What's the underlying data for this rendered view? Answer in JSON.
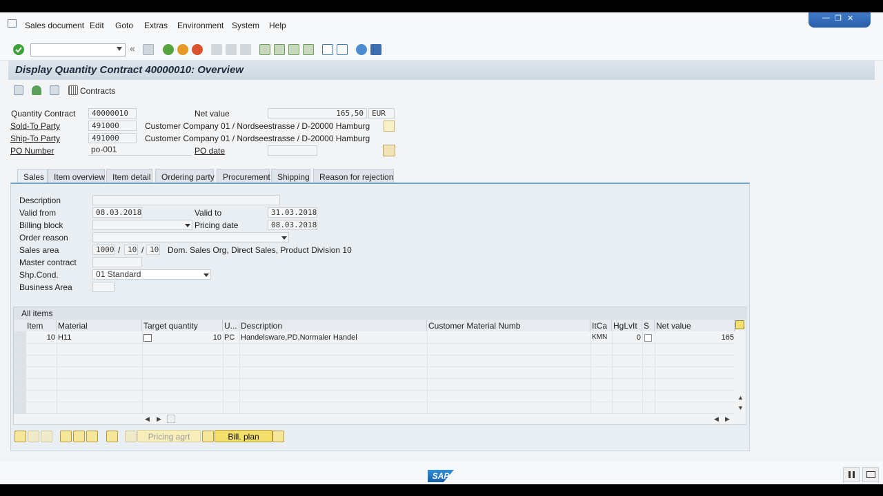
{
  "menu": {
    "items": [
      "Sales document",
      "Edit",
      "Goto",
      "Extras",
      "Environment",
      "System",
      "Help"
    ]
  },
  "window_controls": {
    "minimize": "—",
    "restore": "❐",
    "close": "✕"
  },
  "title": "Display Quantity Contract 40000010: Overview",
  "app_toolbar": {
    "contracts_label": "Contracts"
  },
  "header": {
    "quantity_contract_label": "Quantity Contract",
    "quantity_contract_value": "40000010",
    "net_value_label": "Net value",
    "net_value": "165,50",
    "currency": "EUR",
    "sold_to_label": "Sold-To Party",
    "sold_to_value": "491000",
    "sold_to_desc": "Customer Company 01 / Nordseestrasse / D-20000 Hamburg",
    "ship_to_label": "Ship-To Party",
    "ship_to_value": "491000",
    "ship_to_desc": "Customer Company 01 / Nordseestrasse / D-20000 Hamburg",
    "po_number_label": "PO Number",
    "po_number_value": "po-001",
    "po_date_label": "PO date",
    "po_date_value": ""
  },
  "tabs": [
    "Sales",
    "Item overview",
    "Item detail",
    "Ordering party",
    "Procurement",
    "Shipping",
    "Reason for rejection"
  ],
  "sales_tab": {
    "description_label": "Description",
    "description_value": "",
    "valid_from_label": "Valid from",
    "valid_from_value": "08.03.2018",
    "valid_to_label": "Valid to",
    "valid_to_value": "31.03.2018",
    "billing_block_label": "Billing block",
    "billing_block_value": "",
    "pricing_date_label": "Pricing date",
    "pricing_date_value": "08.03.2018",
    "order_reason_label": "Order reason",
    "order_reason_value": "",
    "sales_area_label": "Sales area",
    "sales_org": "1000",
    "dist_channel": "10",
    "division": "10",
    "sep1": "/",
    "sep2": "/",
    "sales_area_desc": "Dom. Sales Org, Direct Sales, Product Division 10",
    "master_contract_label": "Master contract",
    "master_contract_value": "",
    "shp_cond_label": "Shp.Cond.",
    "shp_cond_value": "01 Standard",
    "business_area_label": "Business Area",
    "business_area_value": ""
  },
  "items_table": {
    "title": "All items",
    "columns": [
      "Item",
      "Material",
      "Target quantity",
      "U...",
      "Description",
      "Customer Material Numb",
      "ItCa",
      "HgLvIt",
      "S",
      "Net value"
    ],
    "rows": [
      {
        "item": "10",
        "material": "H11",
        "target_quantity": "10",
        "unit": "PC",
        "description": "Handelsware,PD,Normaler Handel",
        "customer_material": "",
        "itca": "KMN",
        "hglvit": "0",
        "s": "",
        "net_value": "165"
      }
    ]
  },
  "bottom_toolbar": {
    "pricing_agrt": "Pricing agrt",
    "bill_plan": "Bill. plan"
  },
  "logo": "SAP",
  "colors": {
    "accent": "#6fa0d0",
    "title_bg": "#d5dde6",
    "ok_green": "#3da13a"
  }
}
